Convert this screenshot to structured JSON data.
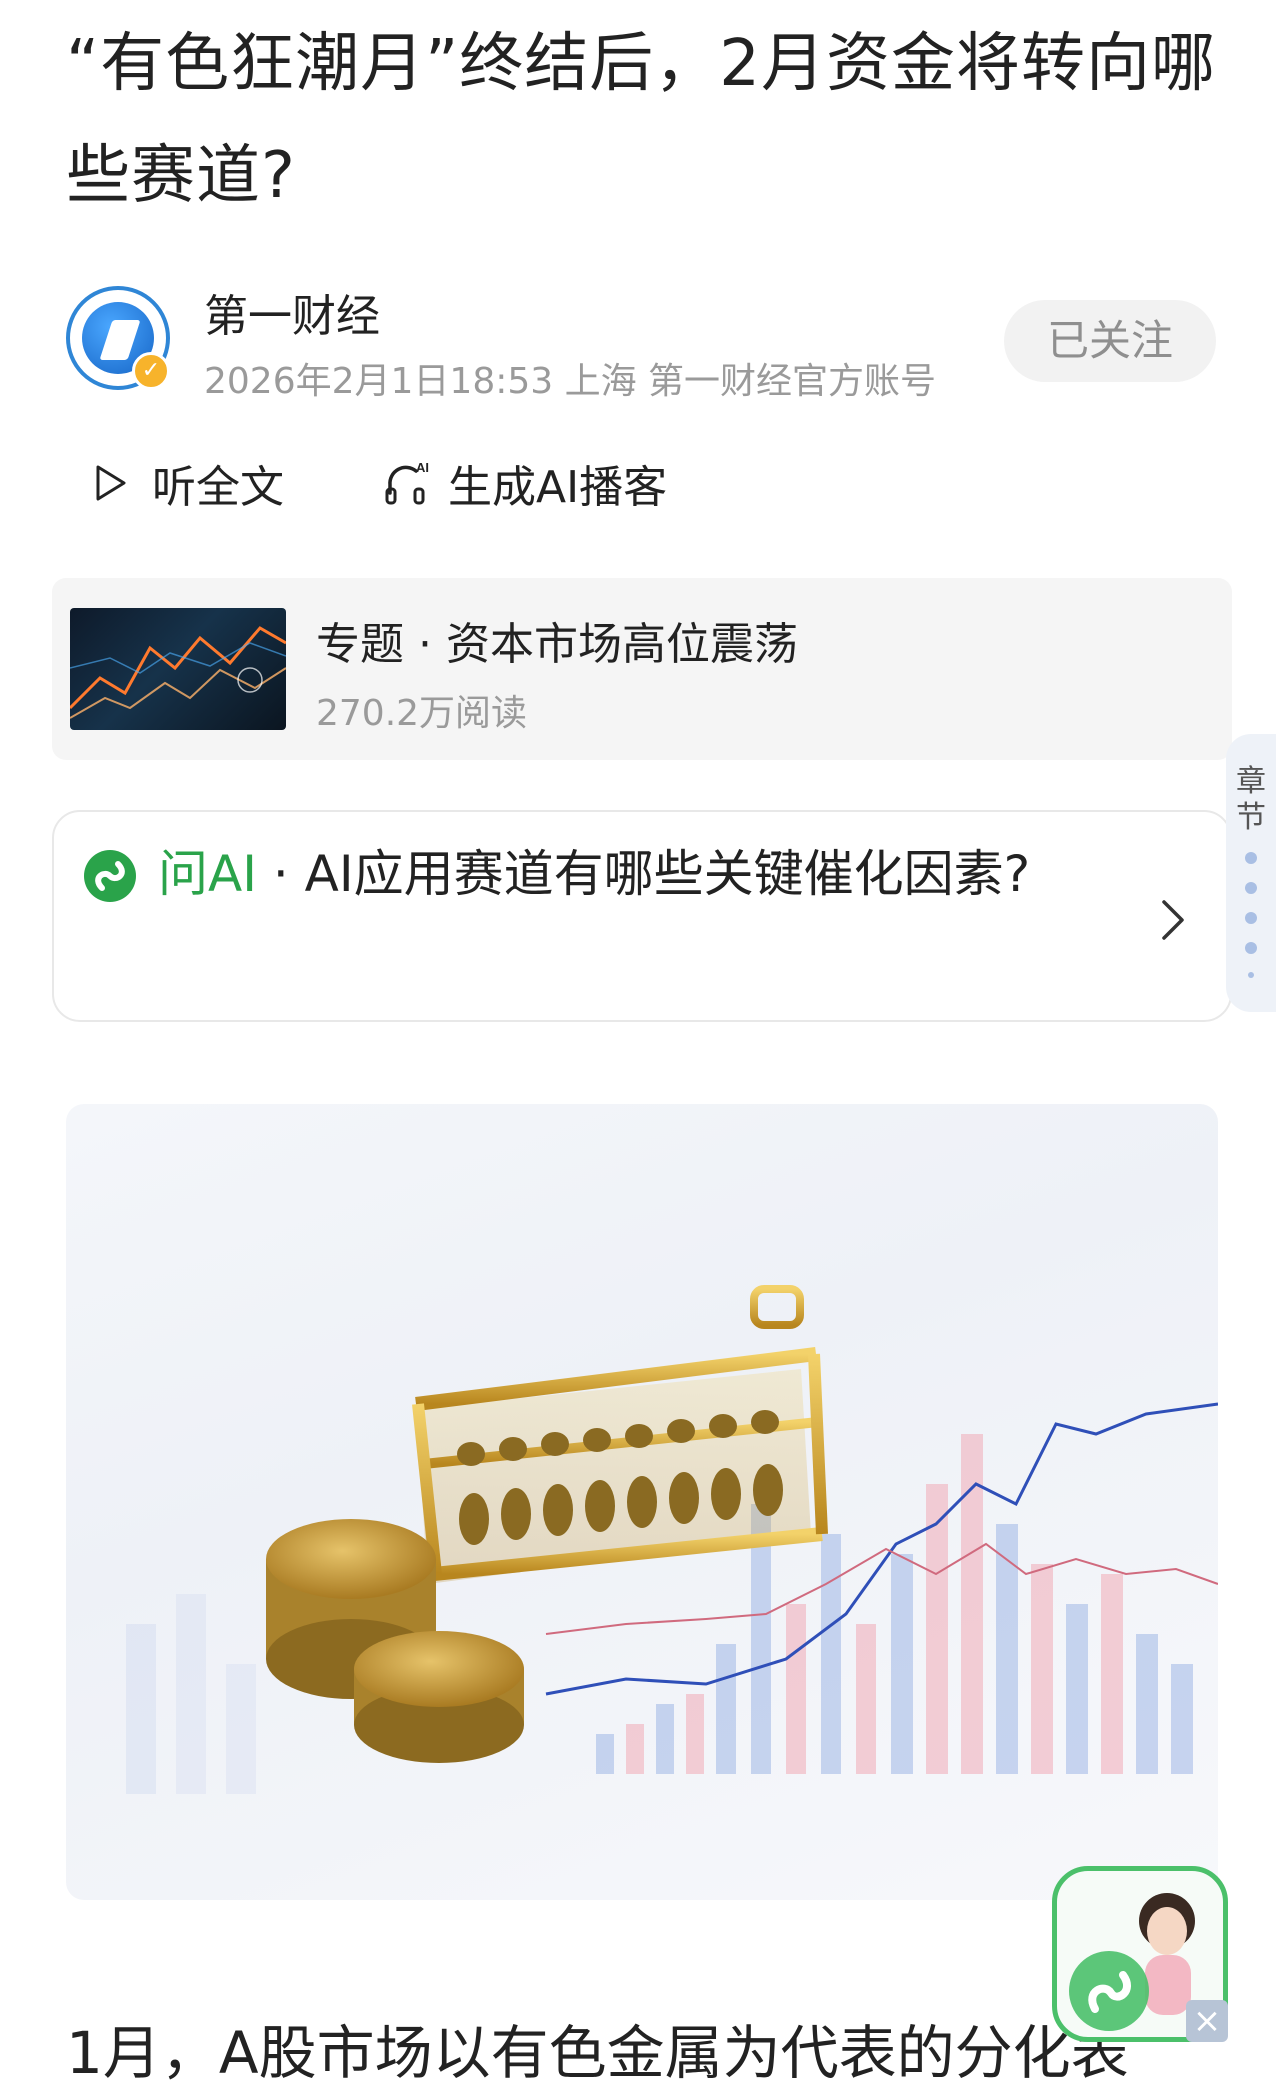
{
  "article": {
    "title": "“有色狂潮月”终结后，2月资金将转向哪些赛道?",
    "body_first_line": "1月，A股市场以有色金属为代表的分化表"
  },
  "author": {
    "name": "第一财经",
    "meta": "2026年2月1日18:53 上海 第一财经官方账号",
    "follow_label": "已关注",
    "avatar_icon": "yicai-logo-icon",
    "verified_icon": "verified-badge-icon"
  },
  "actions": {
    "listen_label": "听全文",
    "podcast_label": "生成AI播客",
    "podcast_icon_badge": "AI"
  },
  "topic": {
    "title": "专题 · 资本市场高位震荡",
    "reads": "270.2万阅读"
  },
  "ask_ai": {
    "label": "问AI",
    "separator": " · ",
    "question": "AI应用赛道有哪些关键催化因素?"
  },
  "chapter_tab": {
    "label": "章节"
  },
  "assistant": {
    "close_glyph": "×"
  },
  "colors": {
    "accent_green": "#2aa34a",
    "follow_bg": "#f2f2f2",
    "meta_gray": "#9a9a9a"
  }
}
